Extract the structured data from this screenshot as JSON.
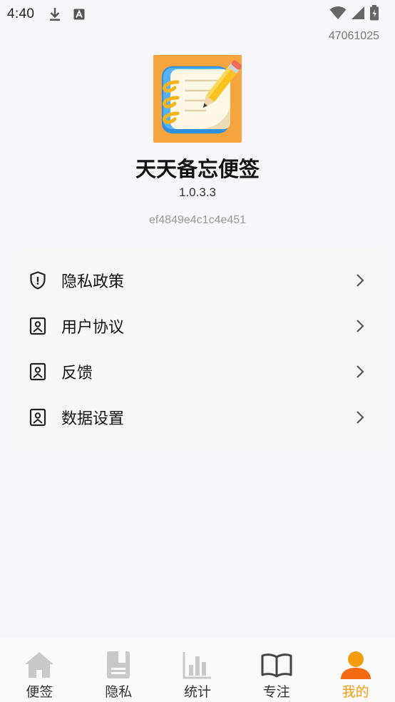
{
  "status_bar": {
    "time": "4:40",
    "icons": [
      "download-icon",
      "text-a-icon",
      "wifi-icon",
      "signal-icon",
      "battery-icon"
    ]
  },
  "build_id": "47061025",
  "app": {
    "name": "天天备忘便签",
    "version": "1.0.3.3",
    "device_id": "ef4849e4c1c4e451",
    "logo_icon": "notebook-pencil-logo"
  },
  "menu": {
    "items": [
      {
        "label": "隐私政策",
        "icon": "shield-icon"
      },
      {
        "label": "用户协议",
        "icon": "bookmark-icon"
      },
      {
        "label": "反馈",
        "icon": "bookmark-icon"
      },
      {
        "label": "数据设置",
        "icon": "bookmark-icon"
      }
    ]
  },
  "nav": {
    "items": [
      {
        "label": "便签",
        "icon": "home-icon"
      },
      {
        "label": "隐私",
        "icon": "notebook-icon"
      },
      {
        "label": "统计",
        "icon": "bar-chart-icon"
      },
      {
        "label": "专注",
        "icon": "book-open-icon"
      },
      {
        "label": "我的",
        "icon": "person-icon",
        "active": true
      }
    ],
    "active_color": "#f39c0f",
    "inactive_color": "#c8c8c8"
  }
}
